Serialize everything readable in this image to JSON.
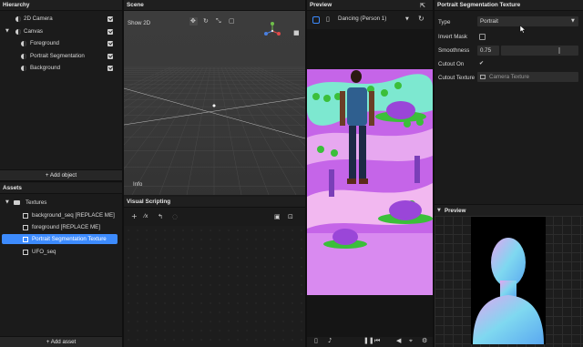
{
  "hierarchy": {
    "title": "Hierarchy",
    "items": [
      {
        "label": "2D Camera"
      },
      {
        "label": "Canvas"
      },
      {
        "label": "Foreground"
      },
      {
        "label": "Portrait Segmentation"
      },
      {
        "label": "Background"
      }
    ],
    "add_button": "+ Add object"
  },
  "assets": {
    "title": "Assets",
    "folder": "Textures",
    "items": [
      {
        "label": "background_seq [REPLACE ME]"
      },
      {
        "label": "foreground [REPLACE ME]"
      },
      {
        "label": "Portrait Segmentation Texture"
      },
      {
        "label": "UFO_seq"
      }
    ],
    "add_button": "+ Add asset"
  },
  "scene": {
    "title": "Scene",
    "show2d": "Show 2D",
    "info": "Info"
  },
  "visual_scripting": {
    "title": "Visual Scripting"
  },
  "preview": {
    "title": "Preview",
    "video_select": "Dancing (Person 1)"
  },
  "inspector": {
    "title": "Portrait Segmentation Texture",
    "type_label": "Type",
    "type_value": "Portrait",
    "invert_mask_label": "Invert Mask",
    "invert_mask": false,
    "smoothness_label": "Smoothness",
    "smoothness_value": "0.75",
    "smoothness_fraction": 0.75,
    "cutout_on_label": "Cutout On",
    "cutout_on": true,
    "cutout_texture_label": "Cutout Texture",
    "cutout_texture_value": "Camera Texture",
    "preview_title": "Preview"
  },
  "colors": {
    "accent": "#3d8bfd",
    "selected_row": "#3d8bfd",
    "panel_bg": "#1b1b1b",
    "header_bg": "#1f1f1f"
  }
}
